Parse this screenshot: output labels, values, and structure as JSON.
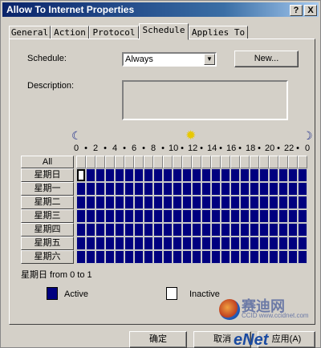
{
  "window": {
    "title": "Allow To Internet Properties",
    "help": "?",
    "close": "X"
  },
  "tabs": [
    {
      "label": "General"
    },
    {
      "label": "Action"
    },
    {
      "label": "Protocol"
    },
    {
      "label": "Schedule",
      "active": true
    },
    {
      "label": "Applies To"
    }
  ],
  "schedule": {
    "label": "Schedule:",
    "value": "Always",
    "new_button": "New..."
  },
  "description": {
    "label": "Description:",
    "value": ""
  },
  "timeline": {
    "hours": [
      "0",
      "•",
      "2",
      "•",
      "4",
      "•",
      "6",
      "•",
      "8",
      "•",
      "10",
      "•",
      "12",
      "•",
      "14",
      "•",
      "16",
      "•",
      "18",
      "•",
      "20",
      "•",
      "22",
      "•",
      "0"
    ],
    "moon_icon": "moon-icon",
    "sun_icon": "sun-icon"
  },
  "grid": {
    "all_label": "All",
    "days": [
      "星期日",
      "星期一",
      "星期二",
      "星期三",
      "星期四",
      "星期五",
      "星期六"
    ],
    "hours_per_day": 24,
    "state": "all-active",
    "focused_cell": {
      "day": 0,
      "hour": 0
    },
    "active_color": "#00007f",
    "inactive_color": "#ffffff"
  },
  "status": "星期日 from 0 to 1",
  "legend": {
    "active": "Active",
    "inactive": "Inactive"
  },
  "footer": {
    "ok": "确定",
    "cancel": "取消",
    "apply": "应用(A)"
  },
  "watermark": {
    "text1": "赛迪网",
    "text2": "CCID www.ccidnet.com",
    "text3": "eNet"
  }
}
